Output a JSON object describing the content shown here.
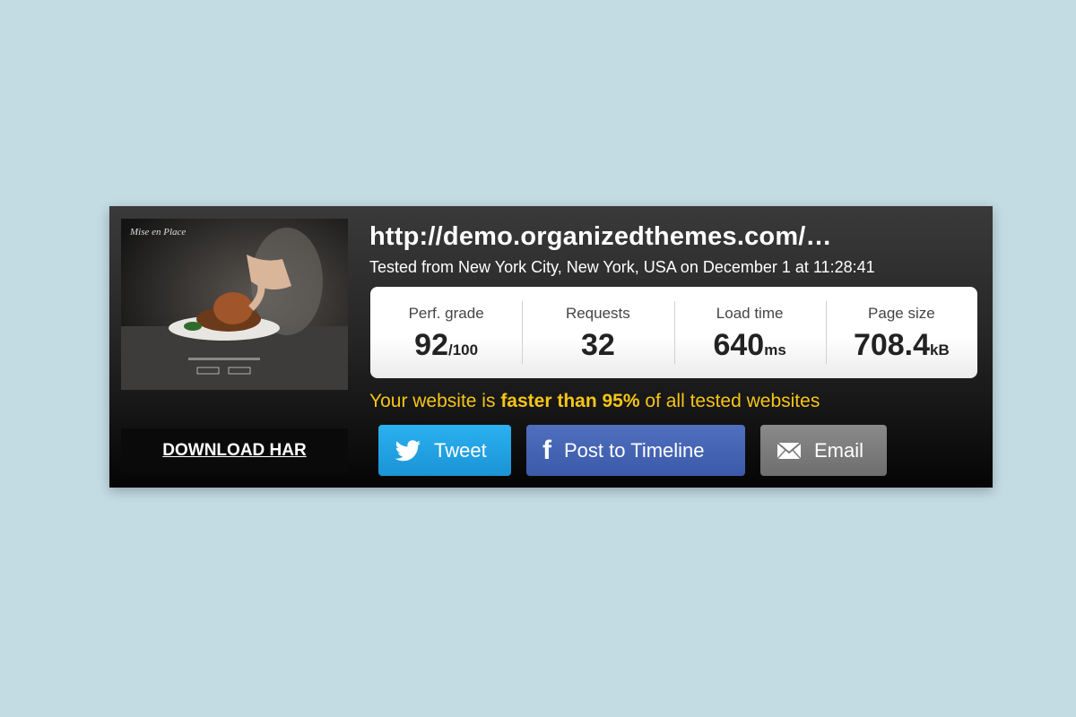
{
  "result": {
    "url": "http://demo.organizedthemes.com/…",
    "tested": "Tested from New York City, New York, USA on December 1 at 11:28:41",
    "faster_prefix": "Your website is ",
    "faster_bold": "faster than 95%",
    "faster_suffix": " of all tested websites"
  },
  "stats": [
    {
      "label": "Perf. grade",
      "value": "92",
      "unit": "/100"
    },
    {
      "label": "Requests",
      "value": "32",
      "unit": ""
    },
    {
      "label": "Load time",
      "value": "640",
      "unit": "ms"
    },
    {
      "label": "Page size",
      "value": "708.4",
      "unit": "kB"
    }
  ],
  "download_har": "DOWNLOAD HAR",
  "share": {
    "tweet": "Tweet",
    "post": "Post to Timeline",
    "email": "Email"
  },
  "colors": {
    "page_bg": "#c3dbe3",
    "highlight": "#f5c518",
    "twitter": "#1a9fe0",
    "facebook": "#3b5aa8",
    "email": "#7a7a7a"
  },
  "icons": {
    "tweet": "twitter-bird-icon",
    "post": "facebook-f-icon",
    "email": "envelope-icon"
  }
}
